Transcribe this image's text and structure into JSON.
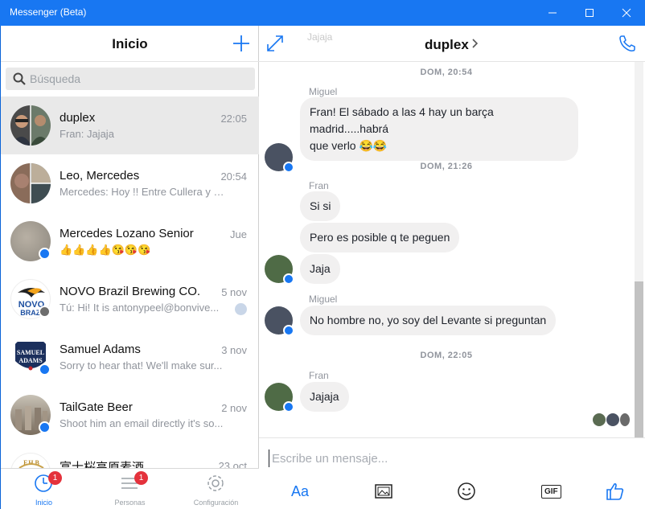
{
  "window": {
    "title": "Messenger (Beta)"
  },
  "sidebar": {
    "title": "Inicio",
    "search_placeholder": "Búsqueda",
    "conversations": [
      {
        "name": "duplex",
        "time": "22:05",
        "preview": "Fran: Jajaja",
        "active": true
      },
      {
        "name": "Leo, Mercedes",
        "time": "20:54",
        "preview": "Mercedes: Hoy !! Entre Cullera y S..."
      },
      {
        "name": "Mercedes Lozano Senior",
        "time": "Jue",
        "preview": "👍👍👍👍😘😘😘"
      },
      {
        "name": "NOVO Brazil Brewing CO.",
        "time": "5 nov",
        "preview": "Tú: Hi! It is antonypeel@bonvive..."
      },
      {
        "name": "Samuel Adams",
        "time": "3 nov",
        "preview": "Sorry to hear that! We'll make sur..."
      },
      {
        "name": "TailGate Beer",
        "time": "2 nov",
        "preview": "Shoot him an email directly it's so..."
      },
      {
        "name": "富士桜高原麦酒",
        "time": "23 oct",
        "preview": ""
      }
    ],
    "nav": [
      {
        "label": "Inicio",
        "count": "1"
      },
      {
        "label": "Personas",
        "count": "1"
      },
      {
        "label": "Configuración",
        "count": ""
      }
    ]
  },
  "chat": {
    "title": "duplex",
    "peek_text": "Jajaja",
    "messages": [
      {
        "stamp": "DOM, 20:54"
      },
      {
        "sender": "Miguel",
        "text_line1": "Fran! El sábado a las 4 hay un barça madrid.....habrá",
        "text_line2": "que verlo 😂😂"
      },
      {
        "stamp": "DOM, 21:26"
      },
      {
        "sender": "Fran",
        "texts": [
          "Si si",
          "Pero es posible q te peguen",
          "Jaja"
        ]
      },
      {
        "sender": "Miguel",
        "text": "No hombre no, yo soy del Levante si preguntan"
      },
      {
        "stamp": "DOM, 22:05"
      },
      {
        "sender": "Fran",
        "text": "Jajaja"
      }
    ],
    "composer_placeholder": "Escribe un mensaje...",
    "tools": {
      "text_format": "Aa",
      "gif": "GIF"
    }
  },
  "colors": {
    "accent": "#1877f2",
    "titlebar": "#1877f2",
    "badge_red": "#e4323c"
  }
}
